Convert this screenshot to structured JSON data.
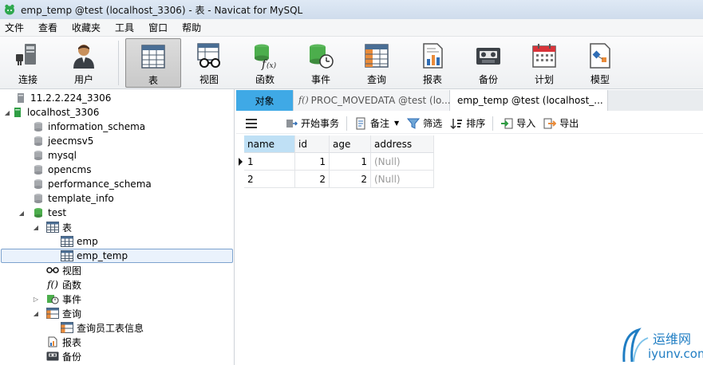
{
  "window": {
    "title": "emp_temp @test (localhost_3306) - 表 - Navicat for MySQL"
  },
  "menu": [
    "文件",
    "查看",
    "收藏夹",
    "工具",
    "窗口",
    "帮助"
  ],
  "toolbar": {
    "connect": "连接",
    "user": "用户",
    "table": "表",
    "view": "视图",
    "function": "函数",
    "event": "事件",
    "query": "查询",
    "report": "报表",
    "backup": "备份",
    "schedule": "计划",
    "model": "模型"
  },
  "tree": {
    "conn1": "11.2.2.224_3306",
    "conn2": "localhost_3306",
    "dbs": [
      "information_schema",
      "jeecmsv5",
      "mysql",
      "opencms",
      "performance_schema",
      "template_info"
    ],
    "test": "test",
    "tables_label": "表",
    "tables": [
      "emp",
      "emp_temp"
    ],
    "views": "视图",
    "functions": "函数",
    "events": "事件",
    "queries": "查询",
    "query_item": "查询员工表信息",
    "reports": "报表",
    "backups": "备份"
  },
  "tabs": {
    "objects": "对象",
    "proc": "PROC_MOVEDATA @test (lo...",
    "current": "emp_temp @test (localhost_..."
  },
  "table_toolbar": {
    "begin_txn": "开始事务",
    "memo": "备注",
    "filter": "筛选",
    "sort": "排序",
    "import": "导入",
    "export": "导出"
  },
  "grid": {
    "columns": [
      "name",
      "id",
      "age",
      "address"
    ],
    "rows": [
      [
        "1",
        "1",
        "1",
        "(Null)"
      ],
      [
        "2",
        "2",
        "2",
        "(Null)"
      ]
    ]
  },
  "watermark": {
    "cn": "运维网",
    "url": "iyunv.com"
  },
  "colors": {
    "tab_objects": "#3fa9e6",
    "selection_border": "#7da2ce",
    "null_text": "#9a9a9a"
  }
}
